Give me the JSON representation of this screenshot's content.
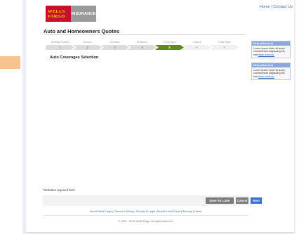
{
  "brand": {
    "logo_line1": "WELLS",
    "logo_line2": "FARGO",
    "logo_badge": "INSURANCE"
  },
  "top_links": {
    "home": "Home",
    "separator": "|",
    "contact": "Contact Us"
  },
  "page_title": "Auto and Homeowners Quotes",
  "progress": {
    "steps": [
      {
        "label": "Getting Started",
        "number": "1",
        "state": "done"
      },
      {
        "label": "Drivers",
        "number": "2",
        "state": "done"
      },
      {
        "label": "Vehicles",
        "number": "3",
        "state": "done"
      },
      {
        "label": "Incidents",
        "number": "4",
        "state": "done"
      },
      {
        "label": "Coverages",
        "number": "5",
        "state": "current"
      },
      {
        "label": "Losses",
        "number": "6",
        "state": "future"
      },
      {
        "label": "Final Page",
        "number": "7",
        "state": "future"
      }
    ]
  },
  "section_title": "Auto Coverages Selection",
  "help_boxes": [
    {
      "title": "Help yellow text",
      "text": "Lorem ipsum dolor sit amet, consectetuer adipiscing elit, sed",
      "link": "diam nonumy."
    },
    {
      "title": "Help yellow text",
      "text": "Lorem ipsum dolor sit amet, consectetuer adipiscing elit, sed",
      "link": "diam nonumy."
    }
  ],
  "required_note": "*Indicates required field.",
  "buttons": {
    "save_later": "Save for Later",
    "cancel": "Cancel",
    "next": "Next"
  },
  "footer": {
    "links": "About Wells Fargo | Careers | Privacy, Security & Legal | Report Email Fraud | Sitemap | Home",
    "copyright": "© 1999 - 2010 Wells Fargo. All rights reserved."
  },
  "colors": {
    "brand_red": "#c8102e",
    "brand_gold": "#ffd200",
    "step_current": "#5e8a16",
    "next_button": "#3d6fd0"
  }
}
